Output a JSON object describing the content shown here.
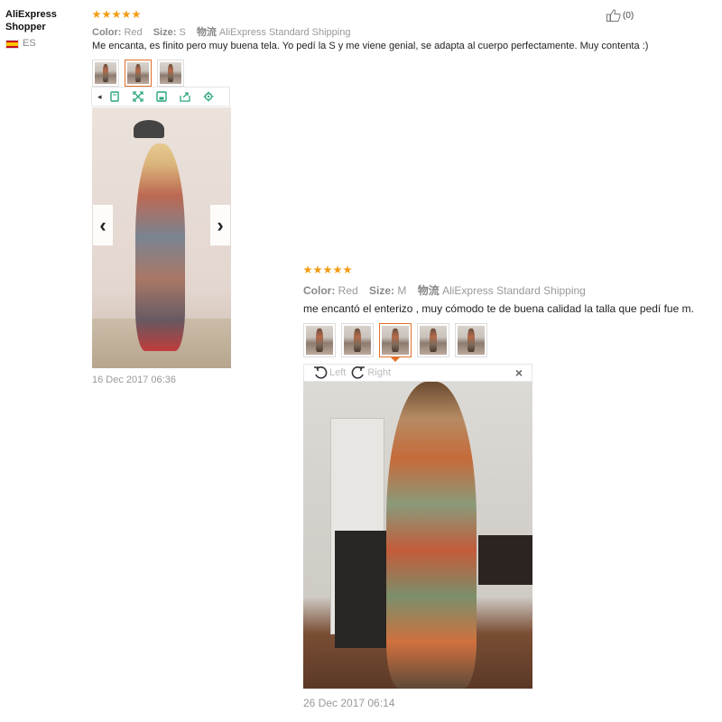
{
  "reviewer": {
    "name_line1": "AliExpress",
    "name_line2": "Shopper",
    "country": "ES"
  },
  "review1": {
    "rating": 5,
    "color_label": "Color:",
    "color_value": "Red",
    "size_label": "Size:",
    "size_value": "S",
    "shipping_cn": "物流",
    "shipping": "AliExpress Standard Shipping",
    "text": "Me encanta, es finito pero muy buena tela. Yo pedí la S y me viene genial, se adapta al cuerpo perfectamente. Muy contenta :)",
    "date": "16 Dec 2017 06:36",
    "likes": "(0)",
    "thumbnail_count": 3,
    "selected_thumbnail": 2
  },
  "review2": {
    "rating": 5,
    "color_label": "Color:",
    "color_value": "Red",
    "size_label": "Size:",
    "size_value": "M",
    "shipping_cn": "物流",
    "shipping": "AliExpress Standard Shipping",
    "text": "me encantó el enterizo , muy cómodo te de buena calidad la talla que pedí fue m.",
    "date": "26 Dec 2017 06:14",
    "thumbnail_count": 5,
    "selected_thumbnail": 3
  },
  "viewer": {
    "rotate_left": "Left",
    "rotate_right": "Right",
    "close": "×",
    "prev": "‹",
    "next": "›"
  },
  "icons": {
    "toolbar1": [
      "copy-icon",
      "fullscreen-icon",
      "save-icon",
      "share-icon",
      "settings-icon"
    ],
    "like": "thumbs-up-icon"
  },
  "colors": {
    "star": "#f39c12",
    "selected_border": "#e0702a",
    "toolbar_icon": "#2aa67a"
  }
}
